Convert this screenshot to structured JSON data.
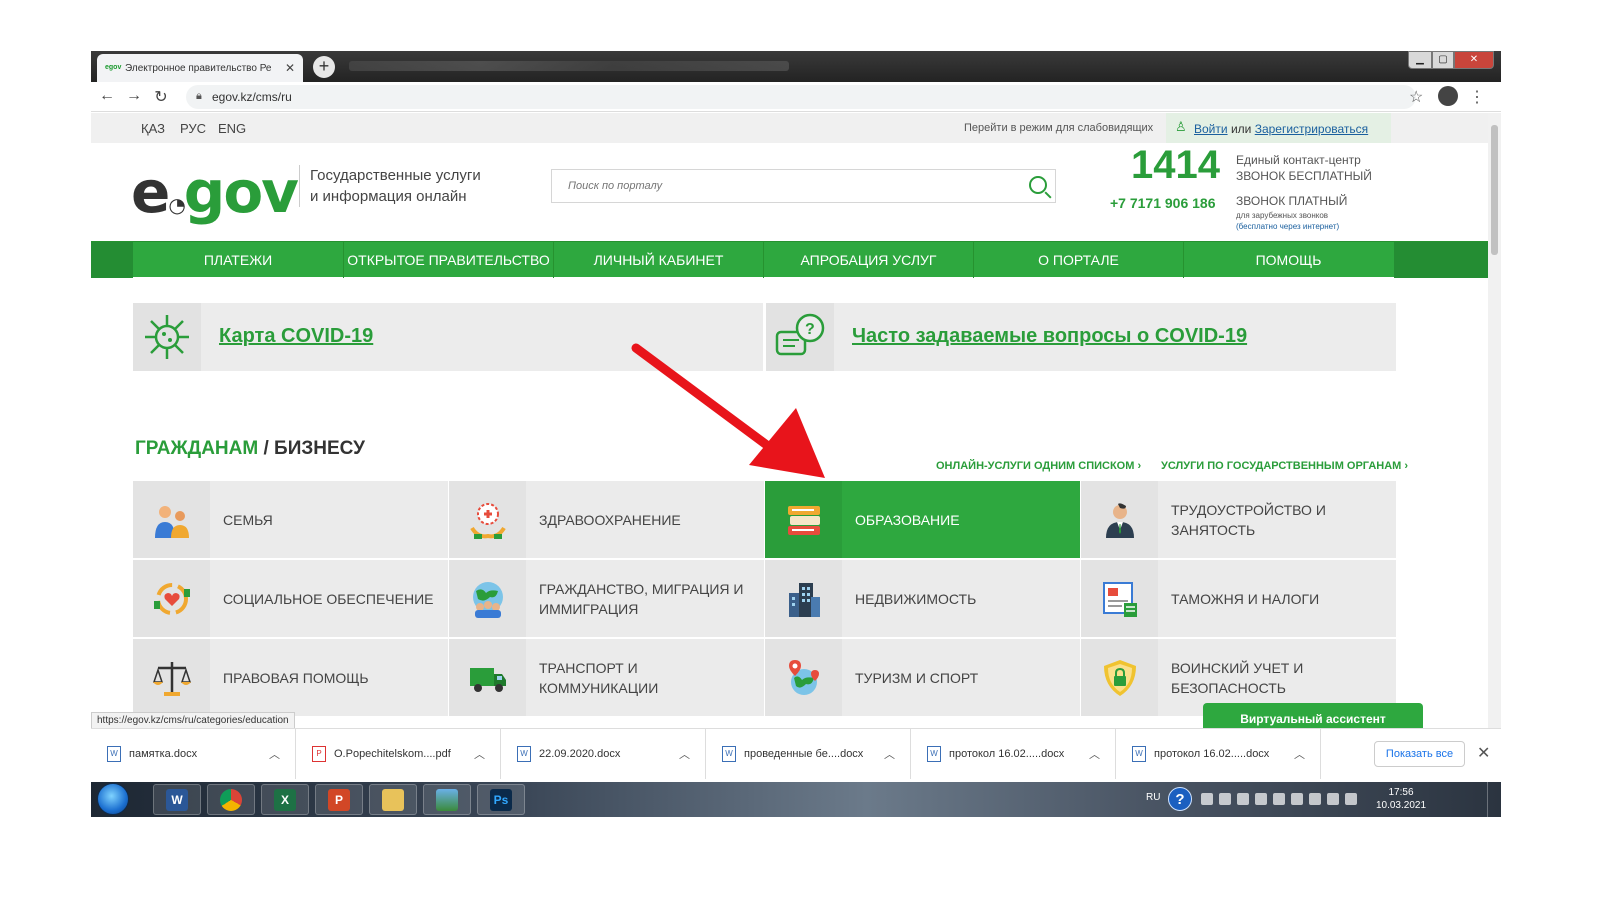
{
  "browser": {
    "tab_title": "Электронное правительство Ре",
    "tab_favicon": "egov",
    "url": "egov.kz/cms/ru",
    "status_url": "https://egov.kz/cms/ru/categories/education"
  },
  "topbar": {
    "languages": [
      "ҚАЗ",
      "РУС",
      "ENG"
    ],
    "accessibility": "Перейти в режим для слабовидящих",
    "login": "Войти",
    "or": "или",
    "register": "Зарегистрироваться"
  },
  "header": {
    "logo": {
      "e": "e",
      "gov": "gov"
    },
    "tagline_line1": "Государственные услуги",
    "tagline_line2": "и информация онлайн",
    "search_placeholder": "Поиск по порталу",
    "contact_number": "1414",
    "contact_label1": "Единый контакт-центр",
    "contact_label1b": "ЗВОНОК БЕСПЛАТНЫЙ",
    "contact_phone": "+7 7171 906 186",
    "contact_label2": "ЗВОНОК ПЛАТНЫЙ",
    "contact_label3": "для зарубежных звонков",
    "contact_label3b": "(бесплатно через интернет)"
  },
  "nav": [
    "ПЛАТЕЖИ",
    "ОТКРЫТОЕ ПРАВИТЕЛЬСТВО",
    "ЛИЧНЫЙ КАБИНЕТ",
    "АПРОБАЦИЯ УСЛУГ",
    "О ПОРТАЛЕ",
    "ПОМОЩЬ"
  ],
  "covid": {
    "map_link": "Карта COVID-19",
    "faq_link": "Часто задаваемые вопросы о COVID-19"
  },
  "section": {
    "title_green": "ГРАЖДАНАМ",
    "title_dark": " / БИЗНЕСУ",
    "link_online": "ОНЛАЙН-УСЛУГИ ОДНИМ СПИСКОМ ›",
    "link_agencies": "УСЛУГИ ПО ГОСУДАРСТВЕННЫМ ОРГАНАМ ›"
  },
  "tiles": [
    {
      "label": "СЕМЬЯ",
      "icon": "family-icon"
    },
    {
      "label": "ЗДРАВООХРАНЕНИЕ",
      "icon": "healthcare-icon"
    },
    {
      "label": "ОБРАЗОВАНИЕ",
      "icon": "books-icon",
      "active": true
    },
    {
      "label": "ТРУДОУСТРОЙСТВО И ЗАНЯТОСТЬ",
      "icon": "employee-icon"
    },
    {
      "label": "СОЦИАЛЬНОЕ ОБЕСПЕЧЕНИЕ",
      "icon": "social-care-icon"
    },
    {
      "label": "ГРАЖДАНСТВО, МИГРАЦИЯ И ИММИГРАЦИЯ",
      "icon": "globe-people-icon"
    },
    {
      "label": "НЕДВИЖИМОСТЬ",
      "icon": "buildings-icon"
    },
    {
      "label": "ТАМОЖНЯ И НАЛОГИ",
      "icon": "tax-document-icon"
    },
    {
      "label": "ПРАВОВАЯ ПОМОЩЬ",
      "icon": "scales-icon"
    },
    {
      "label": "ТРАНСПОРТ И КОММУНИКАЦИИ",
      "icon": "truck-icon"
    },
    {
      "label": "ТУРИЗМ И СПОРТ",
      "icon": "globe-pin-icon"
    },
    {
      "label": "ВОИНСКИЙ УЧЕТ И БЕЗОПАСНОСТЬ",
      "icon": "shield-lock-icon"
    }
  ],
  "assistant": "Виртуальный ассистент",
  "downloads": [
    {
      "name": "памятка.docx",
      "type": "docx"
    },
    {
      "name": "O.Popechitelskom....pdf",
      "type": "pdf"
    },
    {
      "name": "22.09.2020.docx",
      "type": "docx"
    },
    {
      "name": "проведенные бе....docx",
      "type": "docx"
    },
    {
      "name": "протокол 16.02.....docx",
      "type": "docx"
    },
    {
      "name": "протокол 16.02.....docx",
      "type": "docx"
    }
  ],
  "show_all": "Показать все",
  "taskbar": {
    "apps": [
      "word-icon",
      "chrome-icon",
      "excel-icon",
      "powerpoint-icon",
      "explorer-icon",
      "image-viewer-icon",
      "photoshop-icon"
    ],
    "lang": "RU",
    "time": "17:56",
    "date": "10.03.2021"
  },
  "colors": {
    "brand_green": "#2ea83f",
    "arrow_red": "#e8141b"
  }
}
